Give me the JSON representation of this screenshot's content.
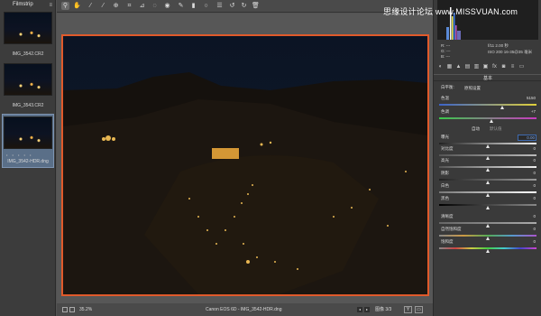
{
  "filmstrip": {
    "title": "Filmstrip",
    "menu_icon": "menu-icon",
    "items": [
      {
        "label": "IMG_3542.CR2",
        "selected": false
      },
      {
        "label": "IMG_3543.CR2",
        "selected": false
      },
      {
        "label": "IMG_3542-HDR.dng",
        "selected": true
      }
    ]
  },
  "toolbar": {
    "tools": [
      "zoom-icon",
      "hand-icon",
      "white-balance-icon",
      "color-sampler-icon",
      "target-adjust-icon",
      "crop-icon",
      "straighten-icon",
      "spot-removal-icon",
      "red-eye-icon",
      "adjustment-brush-icon",
      "graduated-filter-icon",
      "radial-filter-icon",
      "preferences-icon",
      "rotate-left-icon",
      "rotate-right-icon",
      "trash-icon"
    ]
  },
  "watermark": {
    "prefix": "思缘设计论坛",
    "url": "www.MISSVUAN.com"
  },
  "info": {
    "r": "R:",
    "r_val": "---",
    "g": "G:",
    "g_val": "---",
    "b": "B:",
    "b_val": "---",
    "camera_line1": "f/11   2.00 秒",
    "camera_line2": "ISO 200   16-35@35 毫米"
  },
  "panel": {
    "title": "基本",
    "white_balance_label": "白平衡:",
    "white_balance_value": "原照设置",
    "temperature_label": "色温",
    "temperature_value": "5150",
    "tint_label": "色调",
    "tint_value": "+7",
    "auto_label": "自动",
    "default_label": "默认值",
    "sliders": [
      {
        "label": "曝光",
        "value": "0.00",
        "level": 0.5
      },
      {
        "label": "对比度",
        "value": "0",
        "level": 0.5
      },
      {
        "label": "高光",
        "value": "0",
        "level": 0.5
      },
      {
        "label": "阴影",
        "value": "0",
        "level": 0.5
      },
      {
        "label": "白色",
        "value": "0",
        "level": 0.5
      },
      {
        "label": "黑色",
        "value": "0",
        "level": 0.5
      },
      {
        "label": "清晰度",
        "value": "0",
        "level": 0.5
      },
      {
        "label": "自然饱和度",
        "value": "0",
        "level": 0.5
      },
      {
        "label": "饱和度",
        "value": "0",
        "level": 0.5
      }
    ]
  },
  "status": {
    "zoom": "35.2%",
    "caption": "Canon EOS 6D  -  IMG_3542-HDR.dng",
    "image_count": "图像 3/3",
    "y_button": "Y",
    "compare_button": "▭"
  },
  "colors": {
    "selection_border": "#e05a2b",
    "accent": "#3f6bb0"
  }
}
